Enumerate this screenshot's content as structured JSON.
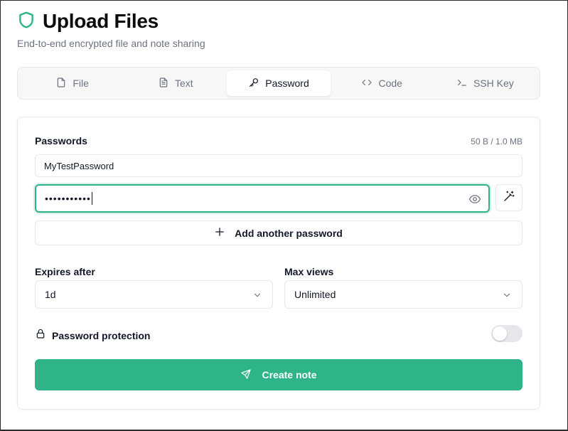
{
  "header": {
    "title": "Upload Files",
    "subtitle": "End-to-end encrypted file and note sharing",
    "logo_icon": "shield-icon"
  },
  "tabs": [
    {
      "label": "File",
      "icon": "file-icon",
      "active": false
    },
    {
      "label": "Text",
      "icon": "file-text-icon",
      "active": false
    },
    {
      "label": "Password",
      "icon": "key-icon",
      "active": true
    },
    {
      "label": "Code",
      "icon": "code-icon",
      "active": false
    },
    {
      "label": "SSH Key",
      "icon": "terminal-icon",
      "active": false
    }
  ],
  "form": {
    "passwords_label": "Passwords",
    "size_info": "50 B / 1.0 MB",
    "password_1_value": "MyTestPassword",
    "password_2_masked": "•••••••••••",
    "add_password_label": "Add another password",
    "expires_label": "Expires after",
    "expires_value": "1d",
    "max_views_label": "Max views",
    "max_views_value": "Unlimited",
    "protection_label": "Password protection",
    "protection_enabled": false,
    "create_label": "Create note"
  },
  "colors": {
    "accent": "#2fb489",
    "border": "#e5e7eb",
    "muted_text": "#6b7280"
  }
}
